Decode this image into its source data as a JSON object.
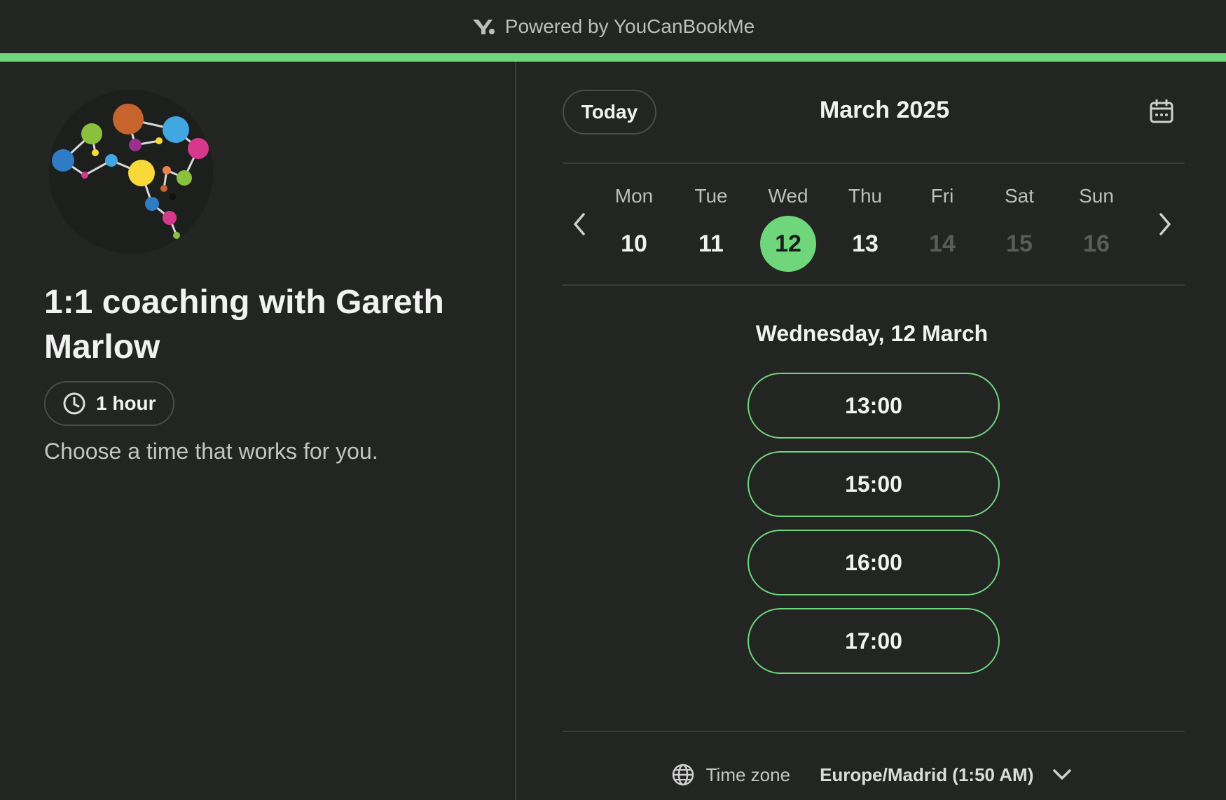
{
  "header": {
    "powered_by": "Powered by YouCanBookMe"
  },
  "colors": {
    "accent": "#6fd67c",
    "background": "#232523"
  },
  "event": {
    "title": "1:1 coaching with Gareth Marlow",
    "duration": "1 hour",
    "description": "Choose a time that works for you."
  },
  "calendar": {
    "today_label": "Today",
    "month": "March 2025",
    "days": [
      {
        "name": "Mon",
        "num": "10",
        "state": "available"
      },
      {
        "name": "Tue",
        "num": "11",
        "state": "available"
      },
      {
        "name": "Wed",
        "num": "12",
        "state": "selected"
      },
      {
        "name": "Thu",
        "num": "13",
        "state": "available"
      },
      {
        "name": "Fri",
        "num": "14",
        "state": "disabled"
      },
      {
        "name": "Sat",
        "num": "15",
        "state": "disabled"
      },
      {
        "name": "Sun",
        "num": "16",
        "state": "disabled"
      }
    ]
  },
  "slots": {
    "date_heading": "Wednesday, 12 March",
    "times": [
      "13:00",
      "15:00",
      "16:00",
      "17:00"
    ]
  },
  "timezone": {
    "label": "Time zone",
    "value": "Europe/Madrid (1:50 AM)"
  }
}
